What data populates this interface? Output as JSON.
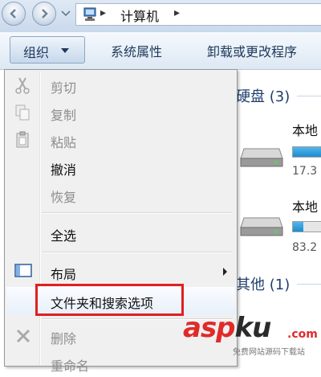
{
  "address_bar": {
    "breadcrumb_separator": "▸",
    "current_location": "计算机",
    "trailing_separator": "▸"
  },
  "toolbar": {
    "organize_label": "组织",
    "system_properties_label": "系统属性",
    "uninstall_label": "卸载或更改程序"
  },
  "background": {
    "hard_drives_header": "硬盘 (3)",
    "drives": [
      {
        "label": "本地",
        "size": "17.3",
        "fill_fraction": 0.92
      },
      {
        "label": "本地",
        "size": "83.2",
        "fill_fraction": 0.35
      }
    ],
    "other_header": "其他 (1)"
  },
  "context_menu": {
    "items": [
      {
        "label": "剪切",
        "enabled": false,
        "icon": "scissors-icon"
      },
      {
        "label": "复制",
        "enabled": false,
        "icon": "copy-icon"
      },
      {
        "label": "粘贴",
        "enabled": false,
        "icon": "paste-icon"
      },
      {
        "label": "撤消",
        "enabled": true,
        "icon": ""
      },
      {
        "label": "恢复",
        "enabled": false,
        "icon": ""
      },
      {
        "label": "全选",
        "enabled": true,
        "icon": ""
      },
      {
        "label": "布局",
        "enabled": true,
        "icon": "layout-icon",
        "submenu": true
      },
      {
        "label": "文件夹和搜索选项",
        "enabled": true,
        "icon": "",
        "highlighted": true
      },
      {
        "label": "删除",
        "enabled": false,
        "icon": "delete-x-icon"
      },
      {
        "label": "重命名",
        "enabled": false,
        "icon": ""
      }
    ]
  },
  "colors": {
    "highlight_box": "#e02020",
    "group_header": "#1e3f6c",
    "disabled_text": "#8d8d8d"
  },
  "watermark": {
    "main_left": "asp",
    "main_right": "ku",
    "suffix": ".com",
    "subtitle": "免费网站源码下载站"
  }
}
